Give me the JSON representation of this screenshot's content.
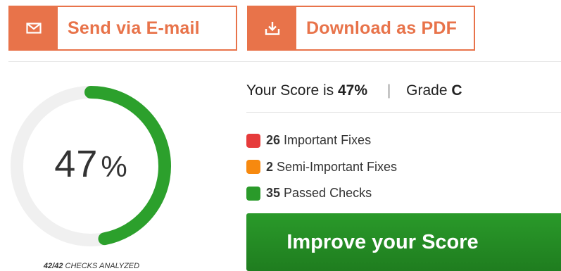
{
  "actions": {
    "email_label": "Send via E-mail",
    "pdf_label": "Download as PDF",
    "email_icon": "envelope-icon",
    "pdf_icon": "download-icon",
    "accent_color": "#e8734a"
  },
  "gauge": {
    "value": "47",
    "percent_sign": "%",
    "fraction": 0.47,
    "color": "#2ca02c",
    "track_color": "#f0f0f0",
    "checks_analyzed": "42/42",
    "checks_analyzed_label": "CHECKS ANALYZED"
  },
  "score": {
    "prefix": "Your Score is",
    "value": "47%",
    "separator": "|",
    "grade_label": "Grade",
    "grade": "C"
  },
  "legend": {
    "items": [
      {
        "count": "26",
        "label": "Important Fixes",
        "color": "#e63b3b"
      },
      {
        "count": "2",
        "label": "Semi-Important Fixes",
        "color": "#f7890f"
      },
      {
        "count": "35",
        "label": "Passed Checks",
        "color": "#2a9a2a"
      }
    ]
  },
  "improve": {
    "label": "Improve your Score"
  }
}
